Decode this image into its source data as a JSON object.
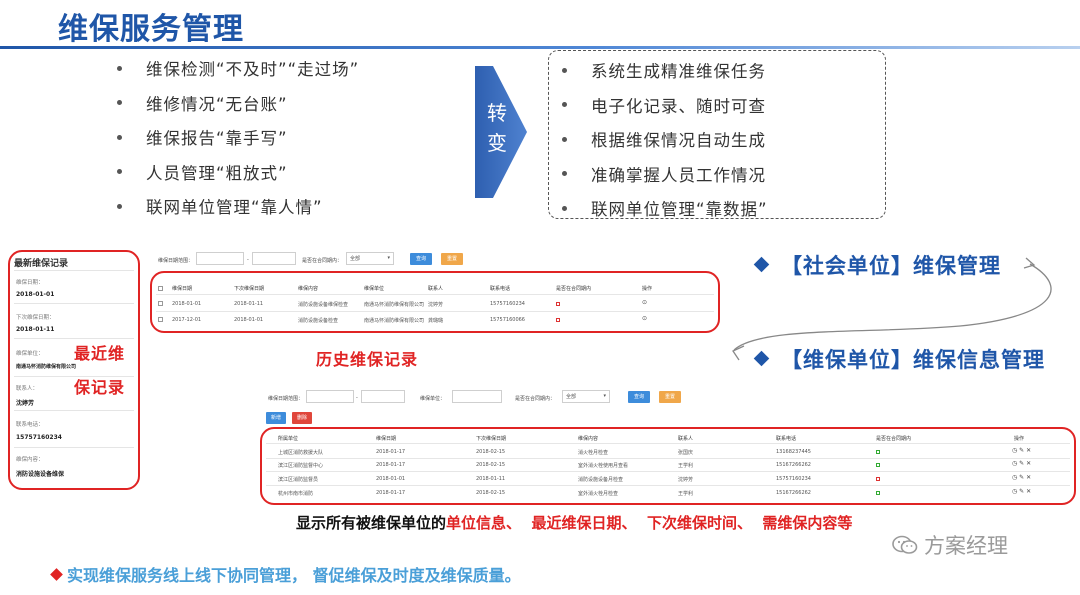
{
  "title": "维保服务管理",
  "before_items": [
    "维保检测“不及时”“走过场”",
    "维修情况“无台账”",
    "维保报告“靠手写”",
    "人员管理“粗放式”",
    "联网单位管理“靠人情”"
  ],
  "arrow_text": "转变",
  "after_items": [
    "系统生成精准维保任务",
    "电子化记录、随时可查",
    "根据维保情况自动生成",
    "准确掌握人员工作情况",
    "联网单位管理“靠数据”"
  ],
  "latest_panel": {
    "title": "最新维保记录",
    "fields": [
      {
        "label": "维保日期：",
        "value": "2018-01-01"
      },
      {
        "label": "下次维保日期：",
        "value": "2018-01-11"
      },
      {
        "label": "维保单位：",
        "value": "南通马怀消防维保有限公司"
      },
      {
        "label": "联系人：",
        "value": "沈婷芳"
      },
      {
        "label": "联系电话：",
        "value": "15757160234"
      },
      {
        "label": "维保内容：",
        "value": "消防设施设备维保"
      }
    ]
  },
  "callout_latest": "最近维保记录",
  "history_filter": {
    "date_label": "维保日期范围：",
    "contract_label": "是否在合同期内：",
    "select_value": "全部",
    "query_label": "查询",
    "reset_label": "重置"
  },
  "history_table": {
    "headers": [
      "维保日期",
      "下次维保日期",
      "维保内容",
      "维保单位",
      "联系人",
      "联系电话",
      "是否在合同期内",
      "操作"
    ],
    "rows": [
      [
        "2018-01-01",
        "2018-01-11",
        "消防设施设备维保检查",
        "南通马怀消防维保有限公司",
        "沈婷芳",
        "15757160234"
      ],
      [
        "2017-12-01",
        "2018-01-01",
        "消防设施设备检查",
        "南通马怀消防维保有限公司",
        "龚璐璐",
        "15757160066"
      ]
    ]
  },
  "callout_history": "历史维保记录",
  "social_label": "【社会单位】维保管理",
  "maint_label": "【维保单位】维保信息管理",
  "unit_filter": {
    "date_label": "维保日期范围：",
    "unit_label": "维保单位：",
    "contract_label": "是否在合同期内：",
    "select_value": "全部",
    "query_label": "查询",
    "reset_label": "重置",
    "add_label": "新增",
    "delete_label": "删除"
  },
  "unit_table": {
    "headers": [
      "所属单位",
      "维保日期",
      "下次维保日期",
      "维保内容",
      "联系人",
      "联系电话",
      "是否在合同期内",
      "操作"
    ],
    "rows": [
      [
        "上城区消防救援大队",
        "2018-01-17",
        "2018-02-15",
        "消火栓月检查",
        "张国庆",
        "13168237445"
      ],
      [
        "滨江区消防监督中心",
        "2018-01-17",
        "2018-02-15",
        "室外消火栓使用月查看",
        "王学利",
        "15167266262"
      ],
      [
        "滨江区消防监督员",
        "2018-01-01",
        "2018-01-11",
        "消防设施设备月检查",
        "沈婷芳",
        "15757160234"
      ],
      [
        "杭州市南市消防",
        "2018-01-17",
        "2018-02-15",
        "室外消火栓月检查",
        "王学利",
        "15167266262"
      ]
    ]
  },
  "display_prefix": "显示所有被维保单位的",
  "display_items": [
    "单位信息、",
    "最近维保日期、",
    "下次维保时间、",
    "需维保内容等"
  ],
  "bottom_text": "实现维保服务线上线下协同管理，  督促维保及时度及维保质量。",
  "watermark": "方案经理",
  "colors": {
    "title_blue": "#1f56a8",
    "alert_red": "#e02424",
    "bottom_blue": "#4a9fd8"
  }
}
